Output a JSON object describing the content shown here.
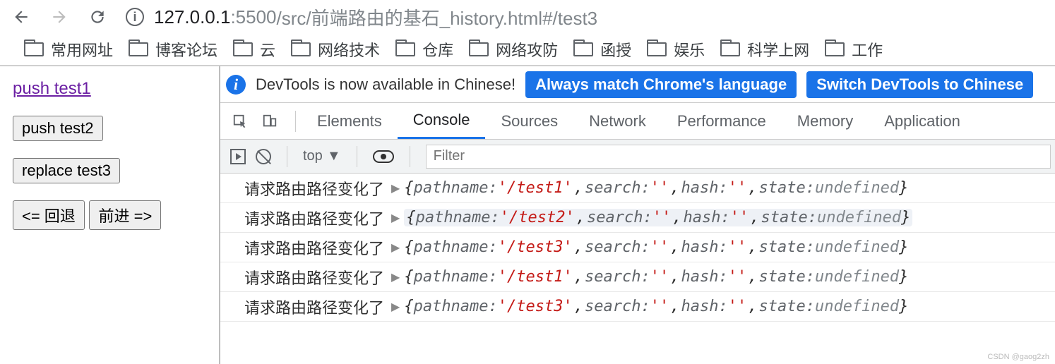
{
  "browser": {
    "url_host": "127.0.0.1",
    "url_port": ":5500",
    "url_path": "/src/前端路由的基石_history.html#/test3"
  },
  "bookmarks": [
    "常用网址",
    "博客论坛",
    "云",
    "网络技术",
    "仓库",
    "网络攻防",
    "函授",
    "娱乐",
    "科学上网",
    "工作"
  ],
  "page": {
    "link_label": "push test1",
    "btn_push2": "push test2",
    "btn_replace3": "replace test3",
    "btn_back": "<= 回退",
    "btn_forward": "前进 =>"
  },
  "devtools": {
    "notice_text": "DevTools is now available in Chinese!",
    "btn_match": "Always match Chrome's language",
    "btn_switch": "Switch DevTools to Chinese",
    "tabs": [
      "Elements",
      "Console",
      "Sources",
      "Network",
      "Performance",
      "Memory",
      "Application"
    ],
    "active_tab": "Console",
    "context_btn": "top",
    "filter_placeholder": "Filter"
  },
  "console": {
    "message_prefix": "请求路由路径变化了",
    "rows": [
      {
        "pathname": "/test1",
        "search": "",
        "hash": "",
        "state": "undefined",
        "highlight": false
      },
      {
        "pathname": "/test2",
        "search": "",
        "hash": "",
        "state": "undefined",
        "highlight": true
      },
      {
        "pathname": "/test3",
        "search": "",
        "hash": "",
        "state": "undefined",
        "highlight": false
      },
      {
        "pathname": "/test1",
        "search": "",
        "hash": "",
        "state": "undefined",
        "highlight": false
      },
      {
        "pathname": "/test3",
        "search": "",
        "hash": "",
        "state": "undefined",
        "highlight": false
      }
    ]
  },
  "watermark": "CSDN @gaog2zh"
}
